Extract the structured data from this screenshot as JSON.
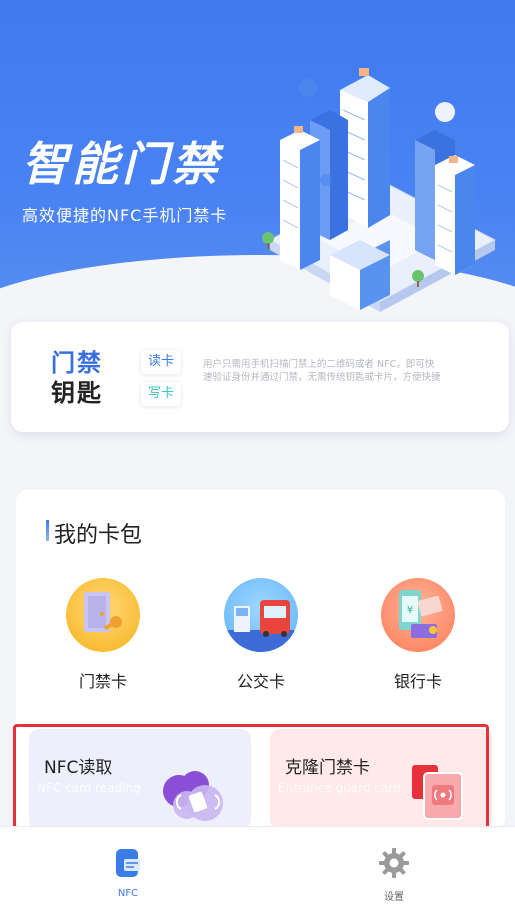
{
  "hero": {
    "title": "智能门禁",
    "subtitle": "高效便捷的NFC手机门禁卡"
  },
  "key_card": {
    "title_line1": "门禁",
    "title_line2": "钥匙",
    "read_label": "读卡",
    "write_label": "写卡",
    "description": "用户只需用手机扫描门禁上的二维码或者 NFC，即可快速验证身份并通过门禁，无需传统钥匙或卡片，方便快捷"
  },
  "wallet": {
    "title": "我的卡包",
    "cards": [
      {
        "label": "门禁卡",
        "icon": "door-card-icon"
      },
      {
        "label": "公交卡",
        "icon": "bus-card-icon"
      },
      {
        "label": "银行卡",
        "icon": "bank-card-icon"
      }
    ],
    "features": [
      {
        "title": "NFC读取",
        "subtitle": "NFC card reading",
        "icon": "nfc-cloud-icon"
      },
      {
        "title": "克隆门禁卡",
        "subtitle": "Entrance guard card",
        "icon": "clone-card-icon"
      }
    ]
  },
  "nav": {
    "items": [
      {
        "label": "NFC",
        "icon": "nfc-tab-icon",
        "active": true
      },
      {
        "label": "设置",
        "icon": "gear-icon",
        "active": false
      }
    ]
  },
  "colors": {
    "brand_blue": "#3f7af0",
    "highlight_red": "#e3323b"
  }
}
